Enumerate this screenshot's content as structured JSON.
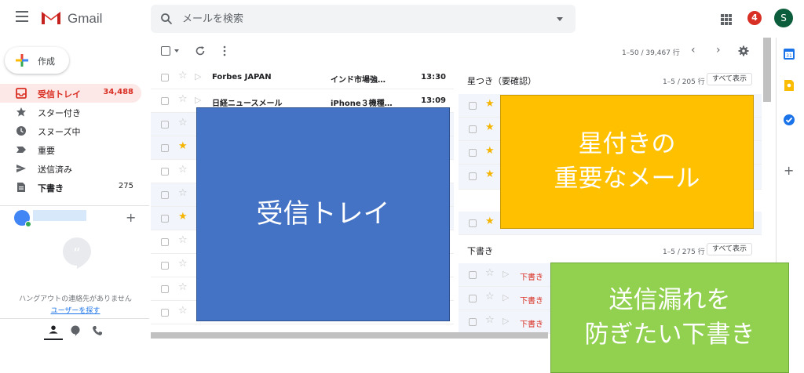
{
  "header": {
    "app_name": "Gmail",
    "search_placeholder": "メールを検索",
    "notification_count": "4",
    "avatar_initial": "S"
  },
  "nav": {
    "compose_label": "作成",
    "items": [
      {
        "label": "受信トレイ",
        "count": "34,488",
        "icon": "inbox-icon",
        "active": true
      },
      {
        "label": "スター付き",
        "count": "",
        "icon": "star-icon"
      },
      {
        "label": "スヌーズ中",
        "count": "",
        "icon": "clock-icon"
      },
      {
        "label": "重要",
        "count": "",
        "icon": "important-icon"
      },
      {
        "label": "送信済み",
        "count": "",
        "icon": "send-icon"
      },
      {
        "label": "下書き",
        "count": "275",
        "icon": "draft-icon"
      }
    ]
  },
  "hangouts": {
    "empty_text": "ハングアウトの連絡先がありません",
    "find_link": "ユーザーを探す"
  },
  "toolbar": {
    "range_text": "1–50 / 39,467 行",
    "prev": "‹",
    "next": "›"
  },
  "inbox": {
    "rows": [
      {
        "from": "Forbes JAPAN",
        "subject": "インド市場強…",
        "time": "13:30",
        "starred": false
      },
      {
        "from": "日経ニュースメール",
        "subject": "iPhone３機種…",
        "time": "13:09",
        "starred": false
      },
      {
        "from": "",
        "subject": "",
        "time": "",
        "starred": false
      },
      {
        "from": "",
        "subject": "",
        "time": "",
        "starred": true
      },
      {
        "from": "",
        "subject": "",
        "time": "",
        "starred": false
      },
      {
        "from": "",
        "subject": "",
        "time": "",
        "starred": false
      },
      {
        "from": "",
        "subject": "",
        "time": "",
        "starred": true
      },
      {
        "from": "",
        "subject": "",
        "time": "",
        "starred": false
      },
      {
        "from": "",
        "subject": "",
        "time": "",
        "starred": false
      },
      {
        "from": "",
        "subject": "",
        "time": "",
        "starred": false
      },
      {
        "from": "",
        "subject": "",
        "time": "",
        "starred": false
      }
    ]
  },
  "starred_section": {
    "title": "星つき（要確認）",
    "range": "1–5 / 205 行",
    "show_all": "すべて表示"
  },
  "drafts_section": {
    "title": "下書き",
    "range": "1–5 / 275 行",
    "show_all": "すべて表示",
    "draft_label": "下書き"
  },
  "overlays": {
    "inbox": "受信トレイ",
    "starred_line1": "星付きの",
    "starred_line2": "重要なメール",
    "drafts_line1": "送信漏れを",
    "drafts_line2": "防ぎたい下書き"
  },
  "colors": {
    "gmail_red": "#d93025",
    "inbox_overlay": "#4472c4",
    "starred_overlay": "#ffc000",
    "drafts_overlay": "#92d050",
    "star_yellow": "#f4b400"
  }
}
